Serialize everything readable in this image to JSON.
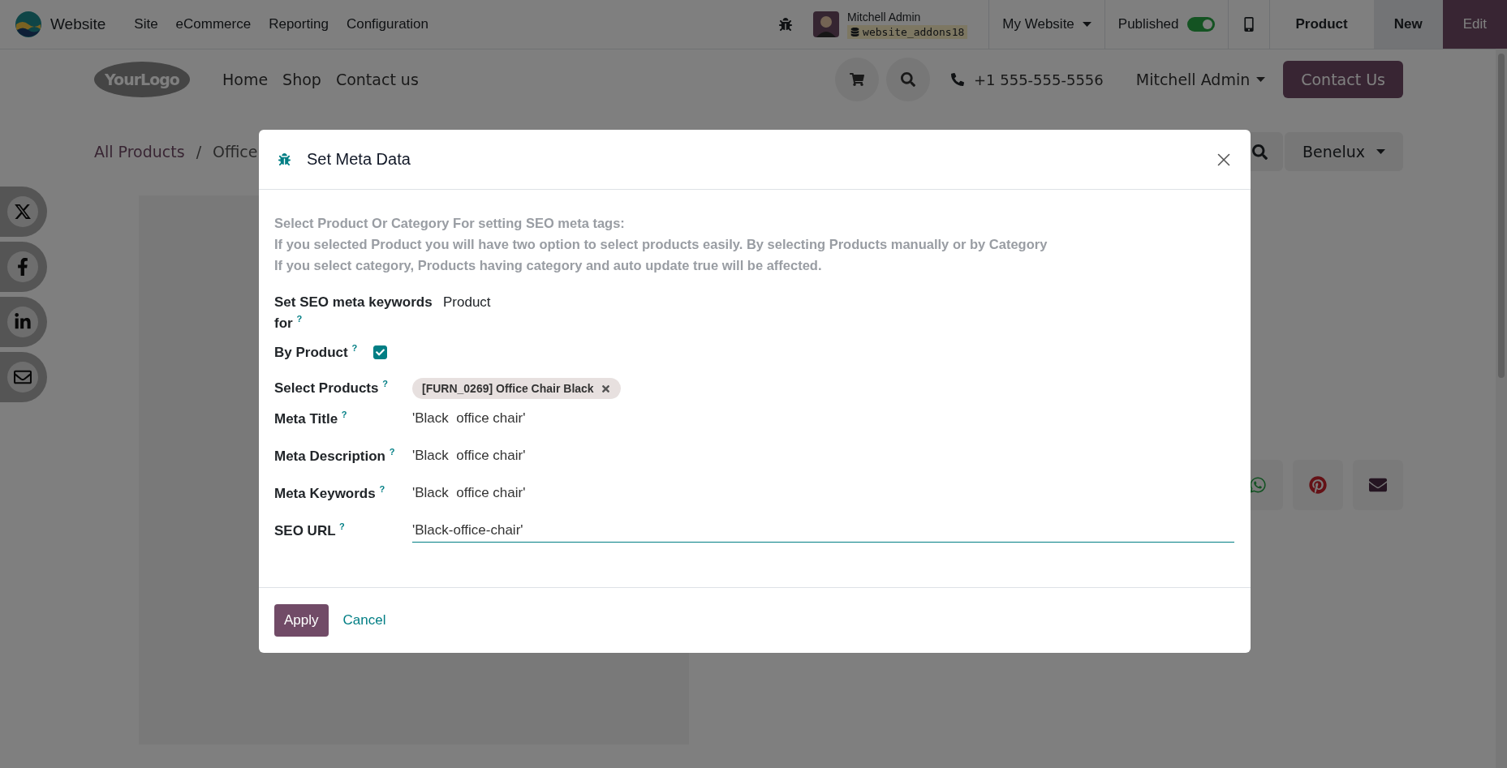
{
  "navbar": {
    "app": "Website",
    "menus": [
      "Site",
      "eCommerce",
      "Reporting",
      "Configuration"
    ],
    "user": {
      "name": "Mitchell Admin",
      "database": "website_addons18"
    },
    "website_switcher": "My Website",
    "published": {
      "label": "Published",
      "on": true
    },
    "buttons": [
      {
        "label": "Product",
        "kind": "plain"
      },
      {
        "label": "New",
        "kind": "secondary"
      },
      {
        "label": "Edit",
        "kind": "primary"
      }
    ]
  },
  "site_header": {
    "logo": "YourLogo",
    "menu": [
      "Home",
      "Shop",
      "Contact us"
    ],
    "phone": "+1 555-555-5556",
    "user": "Mitchell Admin",
    "cta": "Contact Us"
  },
  "breadcrumb": {
    "items": [
      "All Products",
      "Office"
    ],
    "separator": "/"
  },
  "pricelist": "Benelux",
  "dialog": {
    "title": "Set Meta Data",
    "intro": [
      "Select Product Or Category For setting SEO meta tags:",
      "If you selected Product you will have two option to select products easily. By selecting Products manually or by Category",
      "If you select category, Products having category and auto update true will be affected."
    ],
    "fields": [
      {
        "kind": "select",
        "label": "Set SEO meta keywords for $^{?}$",
        "value": "Product"
      },
      {
        "kind": "checkbox",
        "label": "By Product $^{?}$",
        "checked": true
      },
      {
        "kind": "tags",
        "label": "Select Products $^{?}$",
        "tags": [
          "[FURN_0269] Office Chair Black"
        ]
      },
      {
        "kind": "text",
        "label": "Meta Title $^{?}$",
        "value": "'Black  office chair'",
        "focused": false
      },
      {
        "kind": "text",
        "label": "Meta Description $^{?}$",
        "value": "'Black  office chair'",
        "focused": false
      },
      {
        "kind": "text",
        "label": "Meta Keywords $^{?}$",
        "value": "'Black  office chair'",
        "focused": false
      },
      {
        "kind": "text",
        "label": "SEO URL $^{?}$",
        "value": "'Black-office-chair'",
        "focused": true
      }
    ],
    "buttons": [
      {
        "label": "Apply",
        "kind": "primary"
      },
      {
        "label": "Cancel",
        "kind": "link"
      }
    ]
  }
}
